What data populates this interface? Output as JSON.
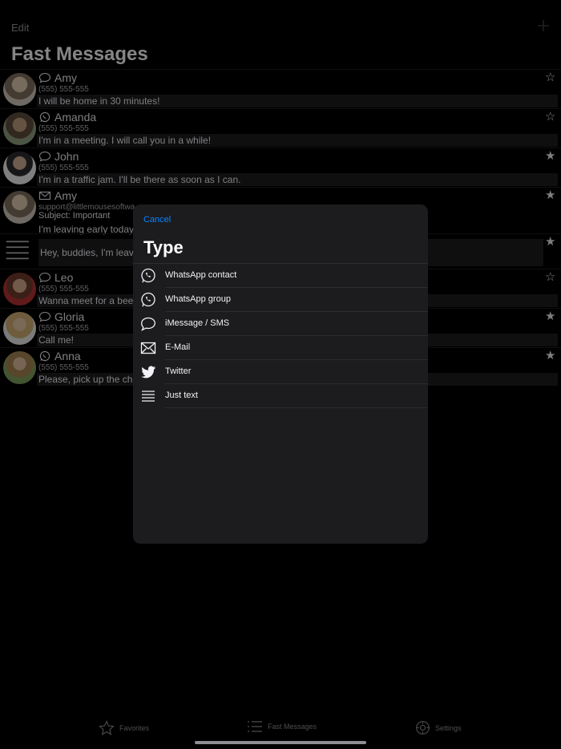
{
  "header": {
    "edit_label": "Edit",
    "add_icon": "plus-icon",
    "title": "Fast Messages"
  },
  "messages": [
    {
      "name": "Amy",
      "type": "imessage",
      "phone": "(555) 555-555",
      "text": "I will be home in 30 minutes!",
      "favorite": false
    },
    {
      "name": "Amanda",
      "type": "whatsapp",
      "phone": "(555) 555-555",
      "text": "I'm in a meeting. I will call you in a while!",
      "favorite": false
    },
    {
      "name": "John",
      "type": "imessage",
      "phone": "(555) 555-555",
      "text": "I'm in a traffic jam. I'll be there as soon as I can.",
      "favorite": true
    },
    {
      "name": "Amy",
      "type": "email",
      "email": "support@littlemousesoftwa",
      "subject": "Subject: Important",
      "text": "I'm leaving early today",
      "favorite": true
    },
    {
      "type": "text",
      "text": "Hey, buddies, I'm leav",
      "favorite": true
    },
    {
      "name": "Leo",
      "type": "imessage",
      "phone": "(555) 555-555",
      "text": "Wanna meet for a bee",
      "favorite": false
    },
    {
      "name": "Gloria",
      "type": "imessage",
      "phone": "(555) 555-555",
      "text": "Call me!",
      "favorite": true
    },
    {
      "name": "Anna",
      "type": "whatsapp",
      "phone": "(555) 555-555",
      "text": "Please, pick up the ch",
      "favorite": true
    }
  ],
  "modal": {
    "cancel_label": "Cancel",
    "title": "Type",
    "options": [
      {
        "label": "WhatsApp contact",
        "icon": "whatsapp-icon"
      },
      {
        "label": "WhatsApp group",
        "icon": "whatsapp-icon"
      },
      {
        "label": "iMessage / SMS",
        "icon": "speech-bubble-icon"
      },
      {
        "label": "E-Mail",
        "icon": "envelope-icon"
      },
      {
        "label": "Twitter",
        "icon": "twitter-bird-icon"
      },
      {
        "label": "Just text",
        "icon": "text-lines-icon"
      }
    ]
  },
  "tabbar": {
    "items": [
      {
        "label": "Favorites",
        "icon": "star-icon"
      },
      {
        "label": "Fast Messages",
        "icon": "list-icon"
      },
      {
        "label": "Settings",
        "icon": "gear-icon"
      }
    ]
  },
  "colors": {
    "accent": "#0a84ff",
    "background": "#000000",
    "sheet": "#1c1c1e"
  }
}
